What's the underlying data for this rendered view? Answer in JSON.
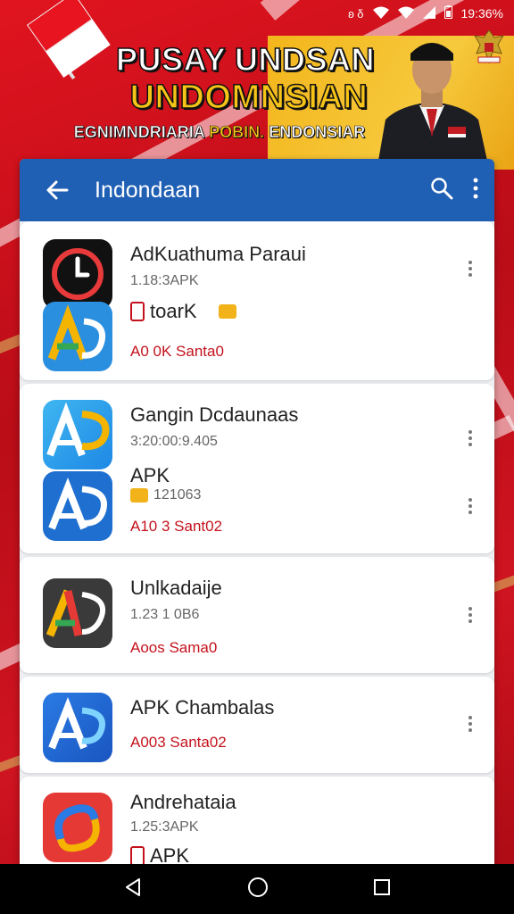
{
  "status_bar": {
    "time": "19:36%",
    "left_icons": "ʚ δ"
  },
  "banner": {
    "title_line1": "PUSAY UNDSAN",
    "title_line2": "UNDOMNSIAN",
    "subtitle_part1": "EGNIMNDRIARIA",
    "subtitle_highlight": "POBIN.",
    "subtitle_part2": "ENDONSIAR"
  },
  "app_bar": {
    "title": "Indondaan",
    "back_icon": "arrow-left-icon",
    "search_icon": "search-icon",
    "menu_icon": "more-vert-icon"
  },
  "cards": [
    {
      "name": "AdKuathuma Paraui",
      "meta": "1.18:3APK",
      "tag": "toarK",
      "version": "A0 0K Santa0"
    },
    {
      "name": "Gangin Dcdaunaas",
      "meta": "3:20:00:9.405",
      "tag": "APK",
      "tag_meta": "121063",
      "version": "A10 3 Sant02"
    },
    {
      "name": "Unlkadaije",
      "meta": "1.23 1 0B6",
      "version": "Aoos Sama0"
    },
    {
      "name": "APK Chambalas",
      "version": "A003 Santa02"
    },
    {
      "name": "Andrehataia",
      "meta": "1.25:3APK",
      "tag": "APK"
    }
  ],
  "colors": {
    "accent_blue": "#1f5fb4",
    "brand_red": "#c8101c",
    "version_red": "#c4121d"
  }
}
